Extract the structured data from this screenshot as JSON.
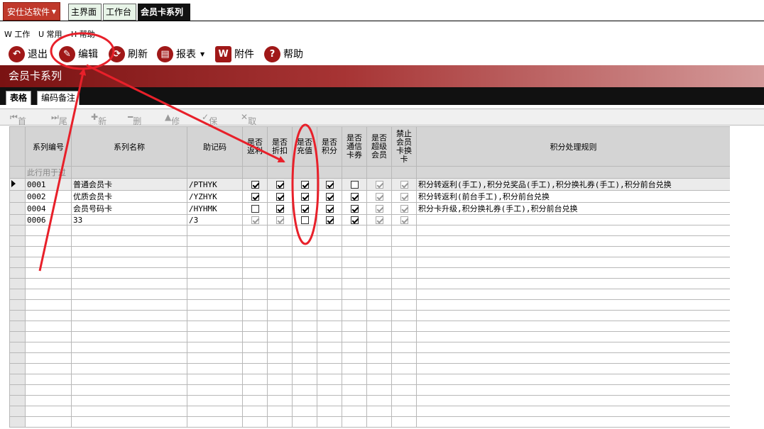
{
  "app": {
    "menu_label": "安仕达软件"
  },
  "tabs": [
    {
      "label": "主界面"
    },
    {
      "label": "工作台"
    },
    {
      "label": "会员卡系列"
    }
  ],
  "menubar": [
    {
      "label": "W 工作"
    },
    {
      "label": "U 常用"
    },
    {
      "label": "H 帮助"
    }
  ],
  "toolbar": {
    "exit": "退出",
    "edit": "编辑",
    "refresh": "刷新",
    "report": "报表",
    "attach": "附件",
    "help": "帮助",
    "attach_glyph": "W"
  },
  "banner": {
    "title": "会员卡系列"
  },
  "subtabs": [
    {
      "label": "表格"
    },
    {
      "label": "编码备注"
    }
  ],
  "nav": {
    "first": "首记录",
    "last": "尾记录",
    "add": "新增",
    "delete": "删除",
    "modify": "修改",
    "save": "保存",
    "cancel": "取消"
  },
  "grid": {
    "columns": [
      "系列编号",
      "系列名称",
      "助记码",
      "是否返利",
      "是否折扣",
      "是否充值",
      "是否积分",
      "是否通信卡券",
      "是否超级会员",
      "禁止会员卡换卡",
      "积分处理规则"
    ],
    "hint_row": "此行用于过",
    "rows": [
      {
        "code": "0001",
        "name": "普通会员卡",
        "mnemonic": "/PTHYK",
        "flags": [
          true,
          true,
          true,
          true,
          false,
          true,
          true
        ],
        "rule": "积分转返利(手工),积分兑奖品(手工),积分换礼券(手工),积分前台兑换"
      },
      {
        "code": "0002",
        "name": "优质会员卡",
        "mnemonic": "/YZHYK",
        "flags": [
          true,
          true,
          true,
          true,
          true,
          true,
          true
        ],
        "rule": "积分转返利(前台手工),积分前台兑换"
      },
      {
        "code": "0004",
        "name": "会员号码卡",
        "mnemonic": "/HYHMK",
        "flags": [
          false,
          true,
          true,
          true,
          true,
          true,
          true
        ],
        "rule": "积分卡升级,积分换礼券(手工),积分前台兑换"
      },
      {
        "code": "0006",
        "name": "33",
        "mnemonic": "/3",
        "flags": [
          true,
          true,
          false,
          true,
          true,
          true,
          true
        ],
        "rule": ""
      }
    ]
  },
  "colors": {
    "accent": "#a01818",
    "banner_start": "#7a1212",
    "annotation": "#e8202a"
  }
}
